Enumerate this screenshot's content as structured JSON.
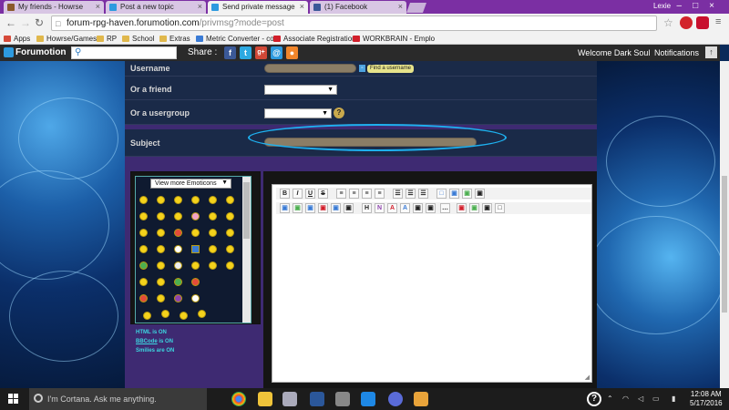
{
  "browser": {
    "tabs": [
      {
        "label": "My friends - Howrse",
        "icon_color": "#8a5a2b"
      },
      {
        "label": "Post a new topic",
        "icon_color": "#2d9adf"
      },
      {
        "label": "Send private message",
        "icon_color": "#2d9adf"
      },
      {
        "label": "(1) Facebook",
        "icon_color": "#3b5998"
      }
    ],
    "profile_name": "Lexie",
    "url_host": "forum-rpg-haven.forumotion.com",
    "url_path": "/privmsg?mode=post",
    "extensions": [
      "opera-icon",
      "adblock-icon",
      "menu-icon"
    ],
    "bookmarks": [
      "Apps",
      "Howrse/Games",
      "RP",
      "School",
      "Extras",
      "Metric Converter - co",
      "Associate Registration",
      "WORKBRAIN - Emplo"
    ]
  },
  "forumotion_bar": {
    "logo": "Forumotion",
    "share_label": "Share :",
    "share_icons": [
      {
        "name": "facebook-icon",
        "glyph": "f",
        "color": "#3b5998"
      },
      {
        "name": "twitter-icon",
        "glyph": "t",
        "color": "#2ca9e1"
      },
      {
        "name": "googleplus-icon",
        "glyph": "g+",
        "color": "#d14836"
      },
      {
        "name": "email-icon",
        "glyph": "@",
        "color": "#2d9adf"
      },
      {
        "name": "rss-icon",
        "glyph": "●",
        "color": "#f0852a"
      }
    ],
    "welcome": "Welcome Dark Soul",
    "notifications": "Notifications",
    "up_glyph": "↑"
  },
  "form": {
    "username_label": "Username",
    "find_username": "Find a username",
    "friend_label": "Or a friend",
    "usergroup_label": "Or a usergroup",
    "subject_label": "Subject",
    "help_glyph": "?",
    "select_arrow": "▼"
  },
  "emoticons": {
    "more_label": "View more Emoticons",
    "status": {
      "html": "HTML is ON",
      "bbcode_link": "BBCode",
      "bbcode_rest": " is ON",
      "smilies": "Smilies are ON"
    }
  },
  "editor": {
    "toolbar_row1": [
      "B",
      "I",
      "U",
      "S",
      "≡",
      "≡",
      "≡",
      "≡",
      "☰",
      "☰",
      "☰",
      "□",
      "▣",
      "▣",
      "▣"
    ],
    "toolbar_row2": [
      "▣",
      "▣",
      "▣",
      "▣",
      "▣",
      "▣",
      "H",
      "N",
      "A",
      "A",
      "▣",
      "▣",
      "…",
      "▣",
      "▣",
      "▣",
      "□"
    ]
  },
  "taskbar": {
    "search_placeholder": "I'm Cortana. Ask me anything.",
    "time": "12:08 AM",
    "date": "5/17/2016",
    "help_glyph": "?"
  }
}
